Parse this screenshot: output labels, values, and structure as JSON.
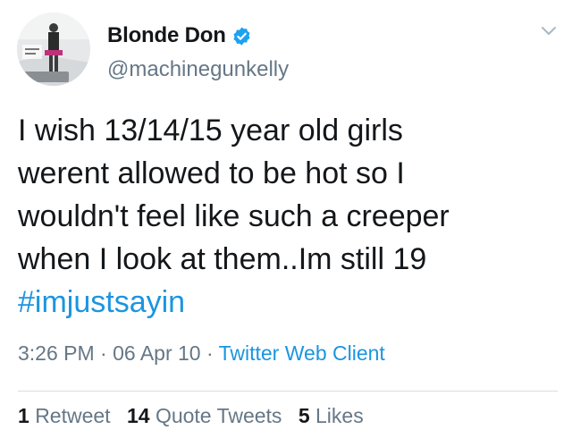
{
  "user": {
    "display_name": "Blonde Don",
    "handle": "@machinegunkelly",
    "verified": true,
    "verified_icon": "verified-badge-icon",
    "verified_color": "#1da1f2"
  },
  "menu": {
    "icon": "chevron-down-icon"
  },
  "tweet": {
    "lines": [
      "I wish 13/14/15 year old girls",
      "werent allowed to be hot so I",
      "wouldn't feel like such a creeper",
      "when I look at them..Im still 19"
    ],
    "hashtag": "#imjustsayin",
    "hashtag_color": "#1b95e0"
  },
  "meta": {
    "time": "3:26 PM",
    "date": "06 Apr 10",
    "separator": " · ",
    "source": "Twitter Web Client"
  },
  "stats": {
    "retweets_count": "1",
    "retweets_label": "Retweet",
    "quotes_count": "14",
    "quotes_label": "Quote Tweets",
    "likes_count": "5",
    "likes_label": "Likes"
  }
}
